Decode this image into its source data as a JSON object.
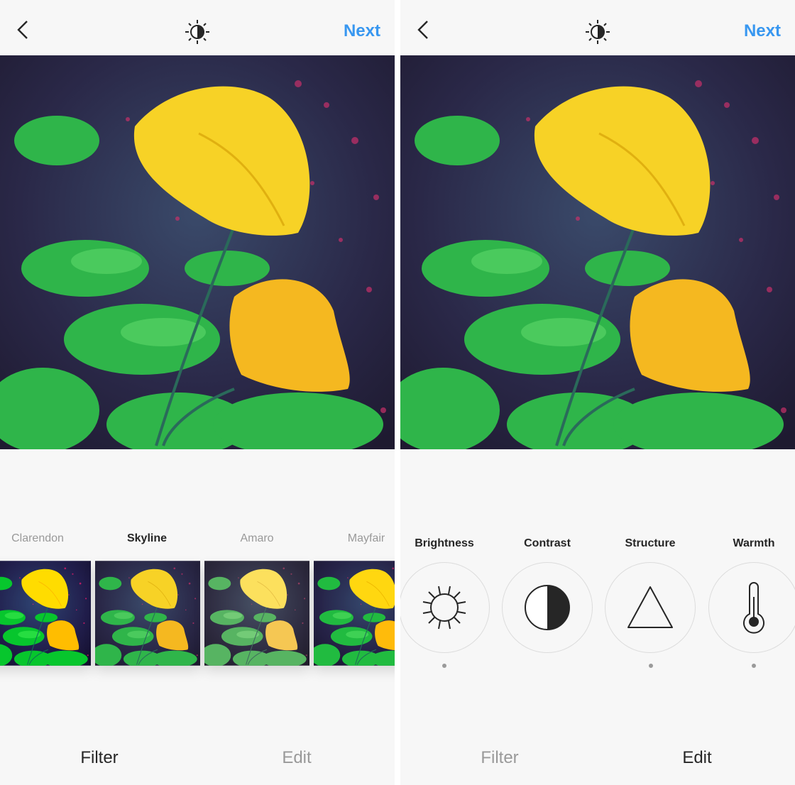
{
  "screens": {
    "filter": {
      "header": {
        "back_icon": "chevron-left-icon",
        "lux_icon": "lux-sun-icon",
        "next_label": "Next"
      },
      "filters": [
        {
          "label": "Clarendon",
          "selected": false
        },
        {
          "label": "Skyline",
          "selected": true
        },
        {
          "label": "Amaro",
          "selected": false
        },
        {
          "label": "Mayfair",
          "selected": false
        }
      ],
      "tabs": [
        {
          "label": "Filter",
          "active": true
        },
        {
          "label": "Edit",
          "active": false
        }
      ]
    },
    "edit": {
      "header": {
        "back_icon": "chevron-left-icon",
        "lux_icon": "lux-sun-icon",
        "next_label": "Next"
      },
      "tools": [
        {
          "label": "Brightness",
          "icon": "sun-icon",
          "adjusted": true
        },
        {
          "label": "Contrast",
          "icon": "contrast-icon",
          "adjusted": false
        },
        {
          "label": "Structure",
          "icon": "triangle-icon",
          "adjusted": true
        },
        {
          "label": "Warmth",
          "icon": "thermometer-icon",
          "adjusted": true
        }
      ],
      "tabs": [
        {
          "label": "Filter",
          "active": false
        },
        {
          "label": "Edit",
          "active": true
        }
      ]
    }
  },
  "colors": {
    "accent": "#3897f0",
    "text": "#262626",
    "muted": "#999999",
    "background": "#f7f7f7"
  }
}
